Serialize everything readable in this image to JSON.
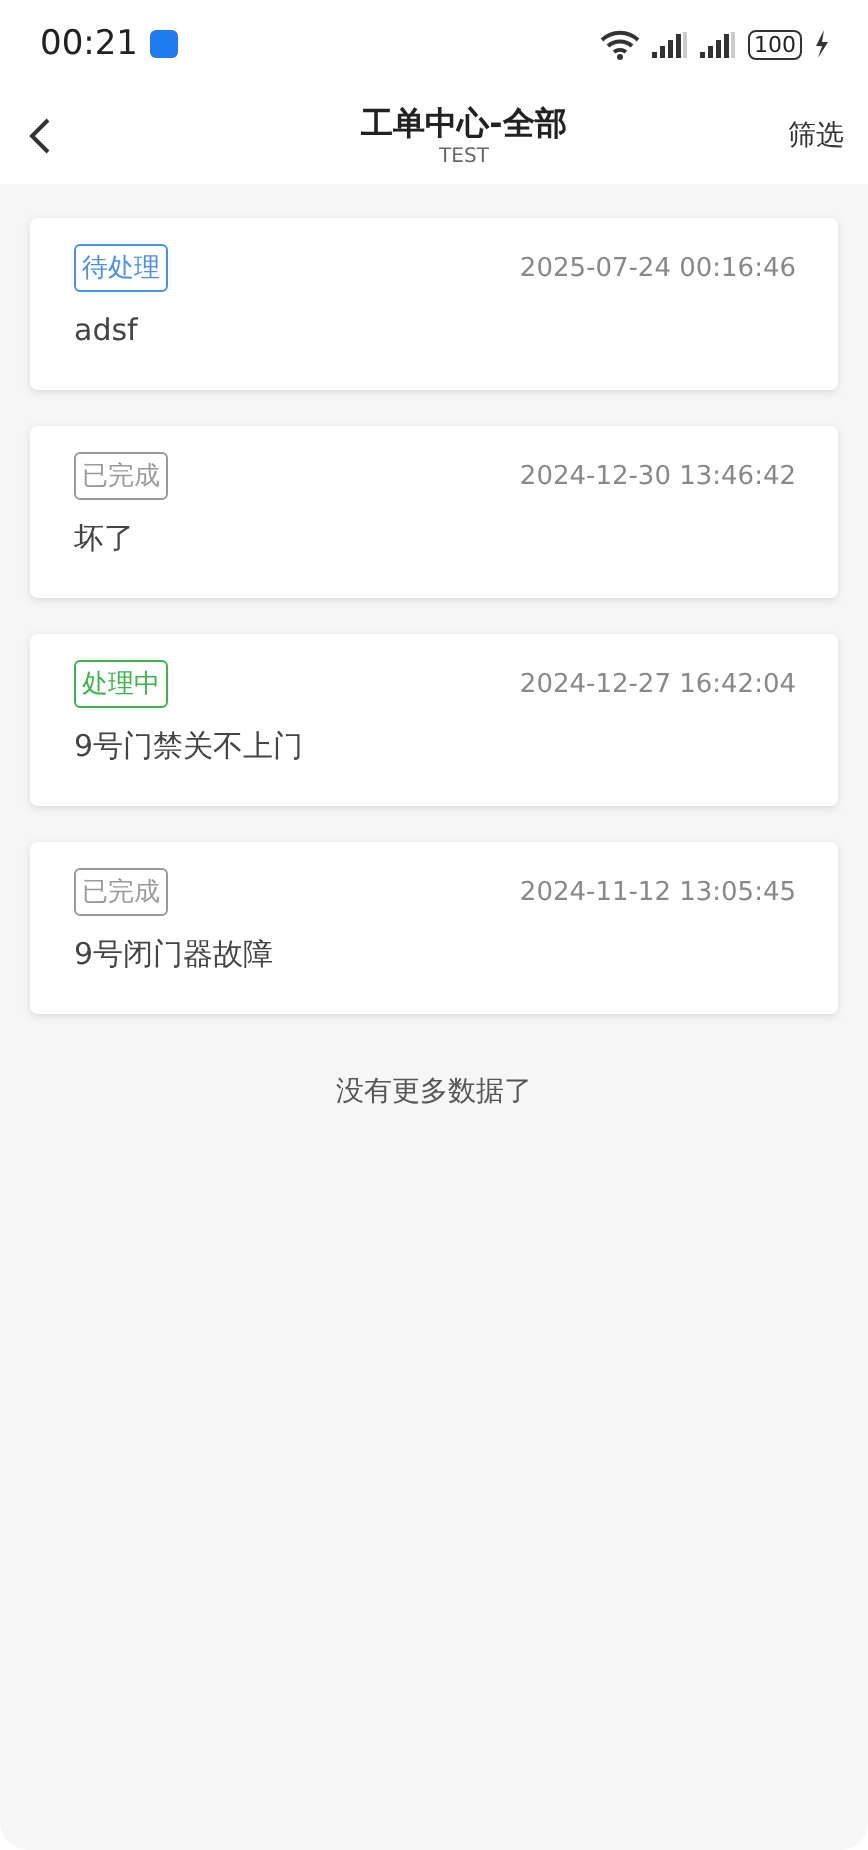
{
  "status_bar": {
    "time": "00:21",
    "battery": "100"
  },
  "header": {
    "title": "工单中心-全部",
    "subtitle": "TEST",
    "action": "筛选"
  },
  "orders": [
    {
      "status": "待处理",
      "color": "#4a8fe8",
      "time": "2025-07-24 00:16:46",
      "title": "adsf"
    },
    {
      "status": "已完成",
      "color": "#9a9a9a",
      "time": "2024-12-30 13:46:42",
      "title": "坏了"
    },
    {
      "status": "处理中",
      "color": "#3cb44b",
      "time": "2024-12-27 16:42:04",
      "title": "9号门禁关不上门"
    },
    {
      "status": "已完成",
      "color": "#9a9a9a",
      "time": "2024-11-12 13:05:45",
      "title": "9号闭门器故障"
    }
  ],
  "footer": "没有更多数据了"
}
